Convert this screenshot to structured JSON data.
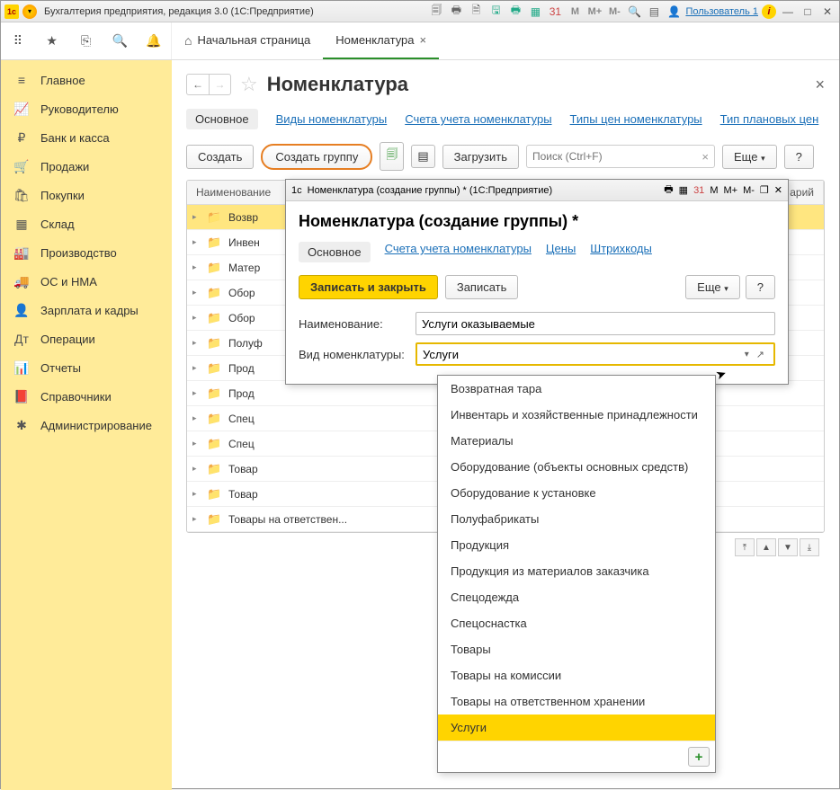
{
  "app": {
    "icon_text": "1c",
    "title": "Бухгалтерия предприятия, редакция 3.0  (1С:Предприятие)",
    "user_label": "Пользователь 1",
    "m_buttons": [
      "M",
      "M+",
      "M-"
    ]
  },
  "left_icons": [
    "⠿",
    "★",
    "⎘",
    "🔍",
    "🔔"
  ],
  "tabs": [
    {
      "label": "Начальная страница",
      "home": true,
      "active": false,
      "closable": false
    },
    {
      "label": "Номенклатура",
      "home": false,
      "active": true,
      "closable": true
    }
  ],
  "sidebar": {
    "items": [
      {
        "icon": "≡",
        "label": "Главное"
      },
      {
        "icon": "📈",
        "label": "Руководителю"
      },
      {
        "icon": "₽",
        "label": "Банк и касса"
      },
      {
        "icon": "🛒",
        "label": "Продажи"
      },
      {
        "icon": "🛍",
        "label": "Покупки"
      },
      {
        "icon": "▦",
        "label": "Склад"
      },
      {
        "icon": "🏭",
        "label": "Производство"
      },
      {
        "icon": "🚚",
        "label": "ОС и НМА"
      },
      {
        "icon": "👤",
        "label": "Зарплата и кадры"
      },
      {
        "icon": "Дт",
        "label": "Операции"
      },
      {
        "icon": "📊",
        "label": "Отчеты"
      },
      {
        "icon": "📕",
        "label": "Справочники"
      },
      {
        "icon": "✱",
        "label": "Администрирование"
      }
    ]
  },
  "page": {
    "title": "Номенклатура",
    "subnav": [
      "Основное",
      "Виды номенклатуры",
      "Счета учета номенклатуры",
      "Типы цен номенклатуры",
      "Тип плановых цен"
    ],
    "subnav_active_index": 0,
    "toolbar": {
      "create": "Создать",
      "create_group": "Создать группу",
      "load": "Загрузить",
      "search_placeholder": "Поиск (Ctrl+F)",
      "search_clear": "×",
      "more": "Еще",
      "help": "?"
    },
    "table": {
      "headers": [
        "Наименование",
        "арий"
      ],
      "rows": [
        {
          "label": "Возвр",
          "selected": true
        },
        {
          "label": "Инвен"
        },
        {
          "label": "Матер"
        },
        {
          "label": "Обор"
        },
        {
          "label": "Обор"
        },
        {
          "label": "Полуф"
        },
        {
          "label": "Прод"
        },
        {
          "label": "Прод"
        },
        {
          "label": "Спец"
        },
        {
          "label": "Спец"
        },
        {
          "label": "Товар"
        },
        {
          "label": "Товар"
        },
        {
          "label": "Товары на ответствен..."
        }
      ]
    }
  },
  "modal": {
    "window_title": "Номенклатура (создание группы) * (1С:Предприятие)",
    "heading": "Номенклатура (создание группы) *",
    "subnav": [
      "Основное",
      "Счета учета номенклатуры",
      "Цены",
      "Штрихкоды"
    ],
    "subnav_active_index": 0,
    "toolbar": {
      "save_close": "Записать и закрыть",
      "save": "Записать",
      "more": "Еще",
      "help": "?"
    },
    "fields": {
      "name_label": "Наименование:",
      "name_value": "Услуги оказываемые",
      "type_label": "Вид номенклатуры:",
      "type_value": "Услуги"
    },
    "m_buttons": [
      "M",
      "M+",
      "M-"
    ]
  },
  "dropdown": {
    "items": [
      "Возвратная тара",
      "Инвентарь и хозяйственные принадлежности",
      "Материалы",
      "Оборудование (объекты основных средств)",
      "Оборудование к установке",
      "Полуфабрикаты",
      "Продукция",
      "Продукция из материалов заказчика",
      "Спецодежда",
      "Спецоснастка",
      "Товары",
      "Товары на комиссии",
      "Товары на ответственном хранении",
      "Услуги"
    ],
    "selected_index": 13,
    "add_label": "+"
  }
}
